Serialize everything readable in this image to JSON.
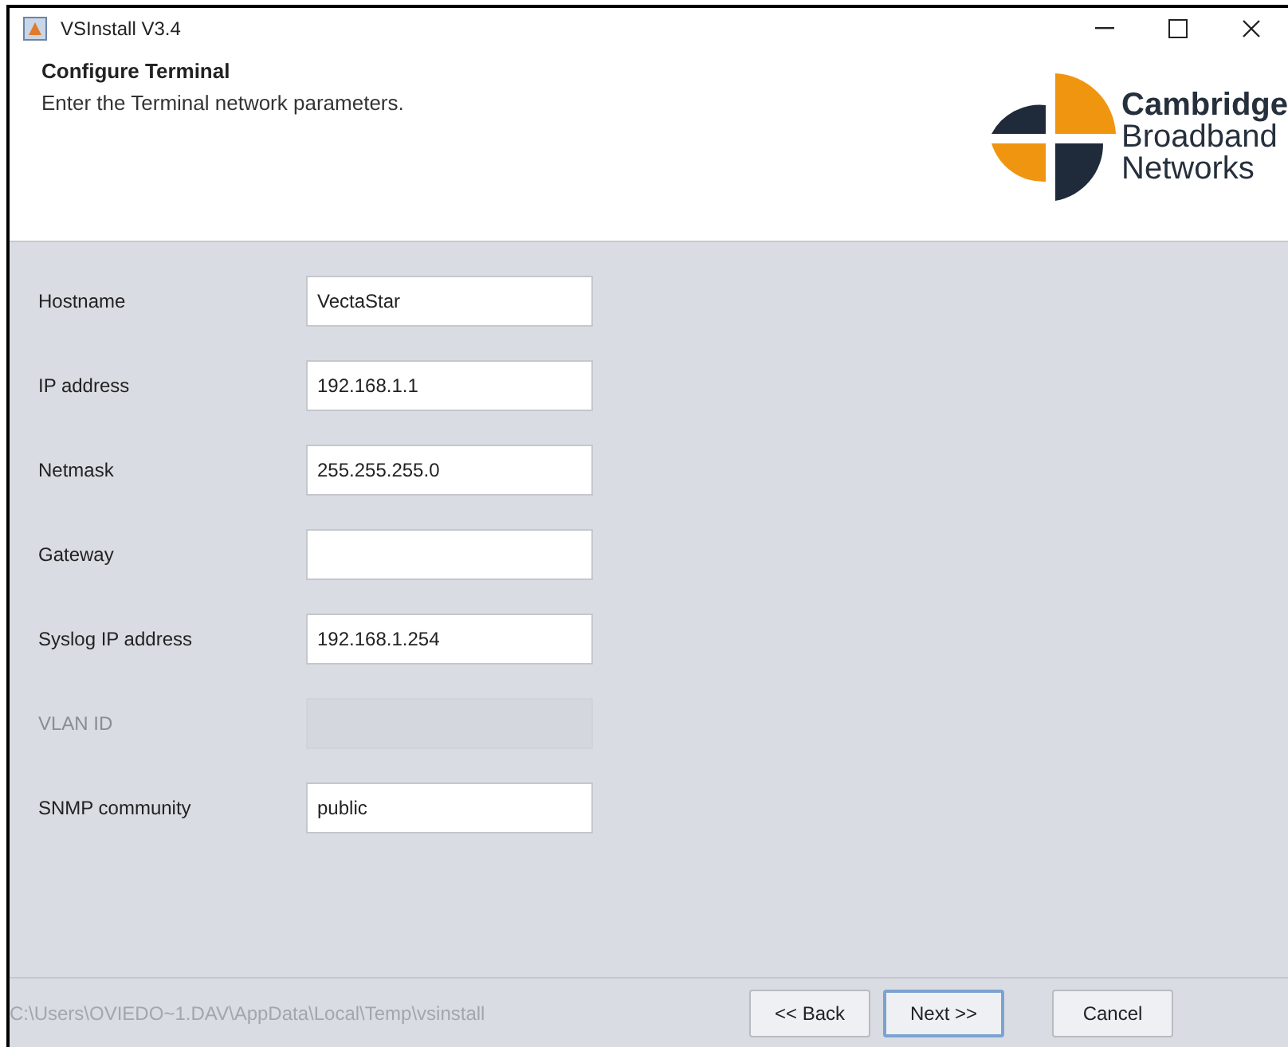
{
  "window": {
    "title": "VSInstall V3.4"
  },
  "header": {
    "title": "Configure Terminal",
    "subtitle": "Enter the Terminal network parameters.",
    "logo": [
      "Cambridge",
      "Broadband",
      "Networks"
    ]
  },
  "fields": [
    {
      "label": "Hostname",
      "value": "VectaStar",
      "disabled": false
    },
    {
      "label": "IP address",
      "value": "192.168.1.1",
      "disabled": false
    },
    {
      "label": "Netmask",
      "value": "255.255.255.0",
      "disabled": false
    },
    {
      "label": "Gateway",
      "disabled": false
    },
    {
      "label": "Syslog IP address",
      "value": "192.168.1.254",
      "disabled": false
    },
    {
      "label": "VLAN ID",
      "disabled": true
    },
    {
      "label": "SNMP community",
      "value": "public",
      "disabled": false
    }
  ],
  "footer": {
    "path": "C:\\Users\\OVIEDO~1.DAV\\AppData\\Local\\Temp\\vsinstall",
    "buttons": [
      {
        "label": "<< Back",
        "focused": false
      },
      {
        "label": "Next >>",
        "focused": true
      },
      {
        "label": "Cancel",
        "focused": false
      }
    ]
  }
}
